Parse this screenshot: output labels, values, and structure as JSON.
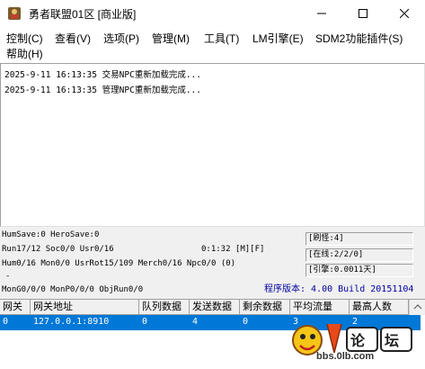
{
  "window": {
    "title": "勇者联盟01区 [商业版]",
    "icon": "app-icon",
    "controls": [
      "minimize-icon",
      "maximize-icon",
      "close-icon"
    ]
  },
  "menu": {
    "items": [
      {
        "label": "控制(C)"
      },
      {
        "label": "查看(V)"
      },
      {
        "label": "选项(P)"
      },
      {
        "label": "管理(M)"
      },
      {
        "label": "工具(T)"
      },
      {
        "label": "LM引擎(E)"
      },
      {
        "label": "SDM2功能插件(S)"
      },
      {
        "label": "帮助(H)"
      }
    ]
  },
  "log": {
    "lines": [
      "2025-9-11 16:13:35 交易NPC重新加载完成...",
      "2025-9-11 16:13:35 管理NPC重新加载完成..."
    ]
  },
  "status": {
    "hum_save": "HumSave:0 HeroSave:0",
    "run": "Run17/12 Soc0/0 Usr0/16",
    "time": "0:1:32 [M][F]",
    "hum": "Hum0/16 Mon0/0 UsrRot15/109 Merch0/16 Npc0/0 (0)",
    "dash": "-",
    "mon_go": "MonG0/0/0 MonP0/0/0 ObjRun0/0",
    "refresh_monster": "[刷怪:4]",
    "online": "[在线:2/2/0]",
    "engine": "[引擎:0.0011天]",
    "version": "程序版本: 4.00 Build 20151104"
  },
  "gateway_table": {
    "headers": [
      "网关",
      "网关地址",
      "队列数据",
      "发送数据",
      "剩余数据",
      "平均流量",
      "最高人数"
    ],
    "rows": [
      [
        "0",
        "127.0.0.1:8910",
        "0",
        "4",
        "0",
        "3",
        "2"
      ]
    ]
  },
  "watermark": {
    "text": "bbs.0lb.com"
  },
  "colors": {
    "selection": "#0078d7",
    "version_text": "#0000a0",
    "panel_bg": "#f0f0f0"
  }
}
